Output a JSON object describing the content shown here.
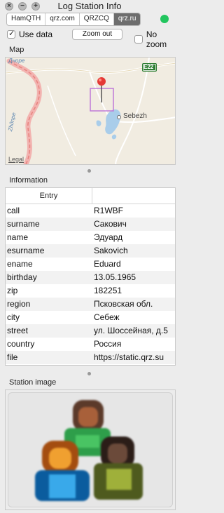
{
  "window": {
    "title": "Log Station Info"
  },
  "tabs": [
    {
      "label": "HamQTH",
      "active": false
    },
    {
      "label": "qrz.com",
      "active": false
    },
    {
      "label": "QRZCQ",
      "active": false
    },
    {
      "label": "qrz.ru",
      "active": true
    }
  ],
  "controls": {
    "use_data_label": "Use data",
    "use_data_checked": true,
    "zoom_out_label": "Zoom out",
    "no_zoom_label": "No zoom",
    "no_zoom_checked": false,
    "status_color": "#22c55e"
  },
  "map": {
    "section_label": "Map",
    "road_badge": "E22",
    "town_label": "Sebezh",
    "river_label_1": "Дноре",
    "river_label_2": "Zhдnpe",
    "legal_label": "Legal"
  },
  "information": {
    "section_label": "Information",
    "column_header": "Entry",
    "rows": [
      [
        "call",
        "R1WBF"
      ],
      [
        "surname",
        "Сакович"
      ],
      [
        "name",
        "Эдуард"
      ],
      [
        "esurname",
        "Sakovich"
      ],
      [
        "ename",
        "Eduard"
      ],
      [
        "birthday",
        "13.05.1965"
      ],
      [
        "zip",
        "182251"
      ],
      [
        "region",
        "Псковская обл."
      ],
      [
        "city",
        "Себеж"
      ],
      [
        "street",
        "ул. Шоссейная, д.5"
      ],
      [
        "country",
        "Россия"
      ],
      [
        "file",
        "https://static.qrz.su"
      ]
    ]
  },
  "station_image": {
    "section_label": "Station image"
  }
}
